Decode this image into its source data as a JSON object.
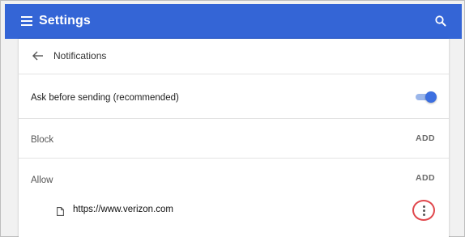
{
  "appbar": {
    "title": "Settings",
    "menu_icon": "hamburger-menu-icon",
    "search_icon": "search-icon",
    "color": "#3465d6"
  },
  "page": {
    "back_icon": "arrow-back-icon",
    "title": "Notifications"
  },
  "ask_before_sending": {
    "label": "Ask before sending (recommended)",
    "enabled": true,
    "accent": "#3c6fe0"
  },
  "block": {
    "label": "Block",
    "add_label": "ADD"
  },
  "allow": {
    "label": "Allow",
    "add_label": "ADD",
    "sites": [
      {
        "icon": "file-icon",
        "url": "https://www.verizon.com",
        "more_icon": "more-vert-icon",
        "highlight_color": "#e0474c"
      }
    ]
  }
}
